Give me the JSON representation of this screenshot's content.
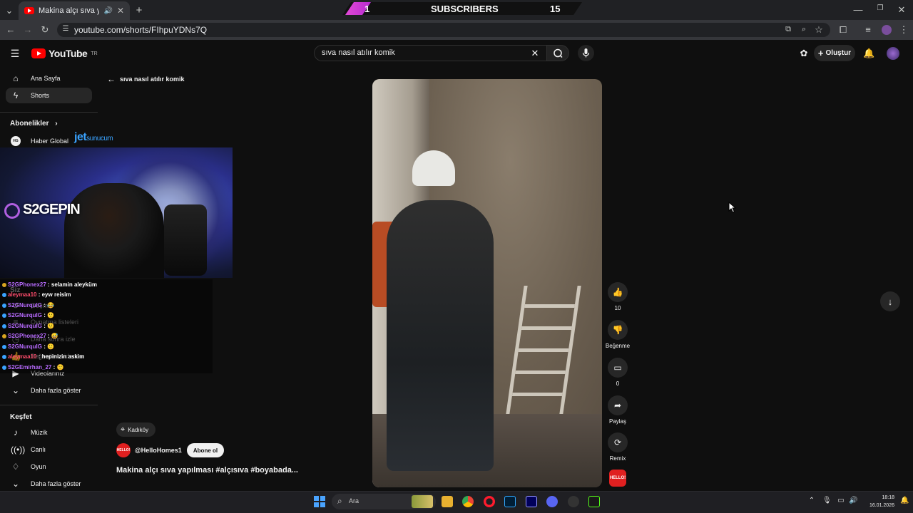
{
  "browser": {
    "tab_title": "Makina alçı sıva yapılması #",
    "url": "youtube.com/shorts/FIhpuYDNs7Q"
  },
  "overlay_banner": {
    "left": "1",
    "center": "SUBSCRIBERS",
    "right": "15"
  },
  "masthead": {
    "logo": "YouTube",
    "region": "TR",
    "search_value": "sıva nasıl atılır komik",
    "create_label": "Oluştur"
  },
  "sidebar": {
    "home": "Ana Sayfa",
    "shorts": "Shorts",
    "subscriptions_head": "Abonelikler",
    "channel_1": "Haber Global",
    "you_head": "Siz",
    "history": "Geçmiş",
    "playlists": "Oynatma listeleri",
    "watch_later": "Daha sonra izle",
    "liked": "Beğenilen videolar",
    "your_videos": "Videolarınız",
    "show_more_1": "Daha fazla göster",
    "explore_head": "Keşfet",
    "music": "Müzik",
    "live": "Canlı",
    "gaming": "Oyun",
    "show_more_2": "Daha fazla göster"
  },
  "stream": {
    "sponsor": "jet",
    "sponsor_suffix": "sunucum",
    "streamer_brand": "S2GEPIN",
    "chat": [
      {
        "user": "S2GPhonex27",
        "msg": ": selamin aleyküm"
      },
      {
        "user": "aleymaa10",
        "msg": ": eyw reisim"
      },
      {
        "user": "S2GNurqulG",
        "msg": ": 😂"
      },
      {
        "user": "S2GNurqulG",
        "msg": ": 🙂"
      },
      {
        "user": "S2GNurqulG",
        "msg": ": 🙂"
      },
      {
        "user": "S2GPhonex27",
        "msg": ": 😅"
      },
      {
        "user": "S2GNurqulG",
        "msg": ": 🙂"
      },
      {
        "user": "aleymaa10",
        "msg": ": hepinizin askim"
      },
      {
        "user": "S2GEmirhan_27",
        "msg": ": 🙂"
      }
    ]
  },
  "shorts": {
    "back_query": "sıva nasıl atılır komik",
    "like_count": "10",
    "dislike_label": "Beğenme",
    "comment_count": "0",
    "share_label": "Paylaş",
    "remix_label": "Remix",
    "location": "Kadıköy",
    "channel": "@HelloHomes1",
    "channel_avatar_text": "HELLO!",
    "subscribe_label": "Abone ol",
    "title": "Makina alçı sıva yapılması #alçısıva #boyabada..."
  },
  "taskbar": {
    "search_placeholder": "Ara",
    "time": "18:18",
    "date": "16.01.2026"
  },
  "colors": {
    "youtube_red": "#ff0000",
    "accent_pink": "#e24ad6",
    "chat_user": "#b86bff"
  }
}
